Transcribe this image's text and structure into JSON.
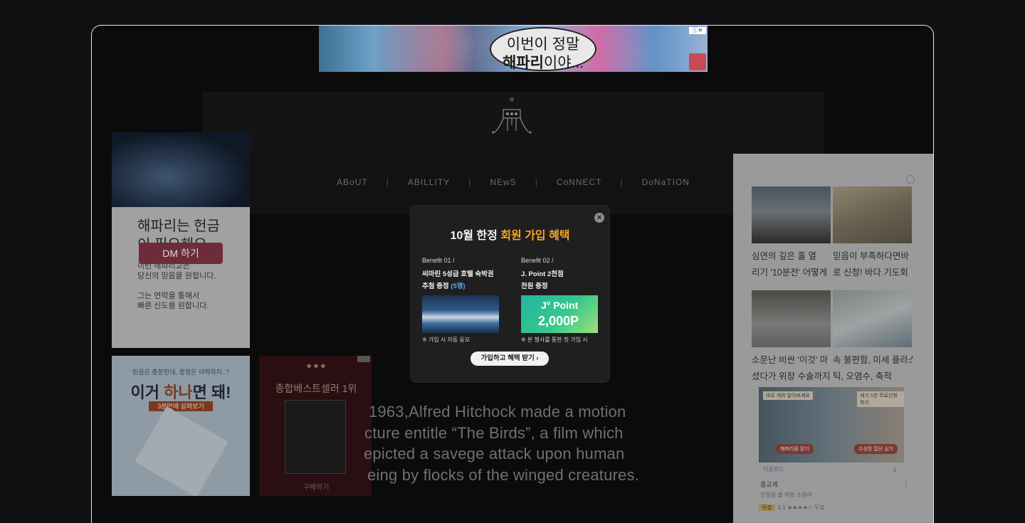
{
  "top_ad": {
    "line1": "이번이 정말",
    "line2_bold": "해파리",
    "line2_rest": "이야..."
  },
  "site": {
    "nav": [
      "ABoUT",
      "ABILLITY",
      "NEwS",
      "CoNNECT",
      "DoNaTION"
    ],
    "separator": "|"
  },
  "left_ad": {
    "headline_l1": "해파리는 헌금",
    "headline_l2": "이 필요해요",
    "p1_l1": "이런 해파리교는",
    "p1_l2": "당신의 믿음을 원합니다.",
    "p2_l1": "그는 연락을 통해서",
    "p2_l2": "빠른 신도를 원합니다.",
    "button": "DM 하기"
  },
  "left_ad2": {
    "small": "믿음은 충분한데, 증명은 어떡하지..?",
    "headline_a": "이거 ",
    "headline_b": "하나",
    "headline_c": "면 돼!",
    "sub": "3분만에 살펴보기"
  },
  "left_ad3": {
    "stars": "★★★",
    "title": "종합베스트셀러 1위",
    "buy": "구매하기"
  },
  "article": {
    "lines": [
      "1963,Alfred Hitchock made a motion",
      "cture entitle “The Birds”, a film which",
      "epicted a savege attack upon human",
      "eing by flocks of the winged creatures."
    ]
  },
  "right_ad": {
    "cards": [
      {
        "l1": "심연의 깊은 홀 열",
        "l2": "리기 '10분전' 어떻게"
      },
      {
        "l1": "믿음이 부족하다면바",
        "l2": "로 신청! 바다 기도회"
      },
      {
        "l1": "소문난 비싼 '이것' 마",
        "l2": "셨다가 위장 수술까지"
      },
      {
        "l1": "속 불편함, 미세 플라스",
        "l2": "틱, 오염수, 축적"
      }
    ],
    "banner_pill1": "바로 캐와 알아보세요",
    "banner_pill2": "세기 1만 무료신청하기",
    "banner_btn1": "해파리를 믿기",
    "banner_btn2": "수상한 집단 심기",
    "download": "다운로드",
    "app_name": "종교게",
    "app_sub": "신앙심 쿨 위한 소원리",
    "rating_tag": "무료",
    "rating": "4.1 ★★★★☆ 무료"
  },
  "popup": {
    "title_a": "10월 한정 ",
    "title_b": "회원 가입 혜택",
    "close": "×",
    "benefit1": {
      "label": "Benefit 01 /",
      "desc_l1": "씨마린 5성급 호텔 숙박권",
      "desc_l2a": "추첨 증정 ",
      "desc_l2b": "(5명)",
      "note": "※ 가입 시 자동 응모"
    },
    "benefit2": {
      "label": "Benefit 02 /",
      "desc_l1": "J. Point 2천점",
      "desc_l2a": "전원 증정",
      "img_brand": "J° Point",
      "img_points": "2,000P",
      "note": "※ 본 행사를 통한 첫 가입 시"
    },
    "cta": "가입하고 혜택 받기  ›"
  },
  "colors": {
    "accent": "#f5a623",
    "highlight_blue": "#58a6ff",
    "background": "#111113"
  }
}
